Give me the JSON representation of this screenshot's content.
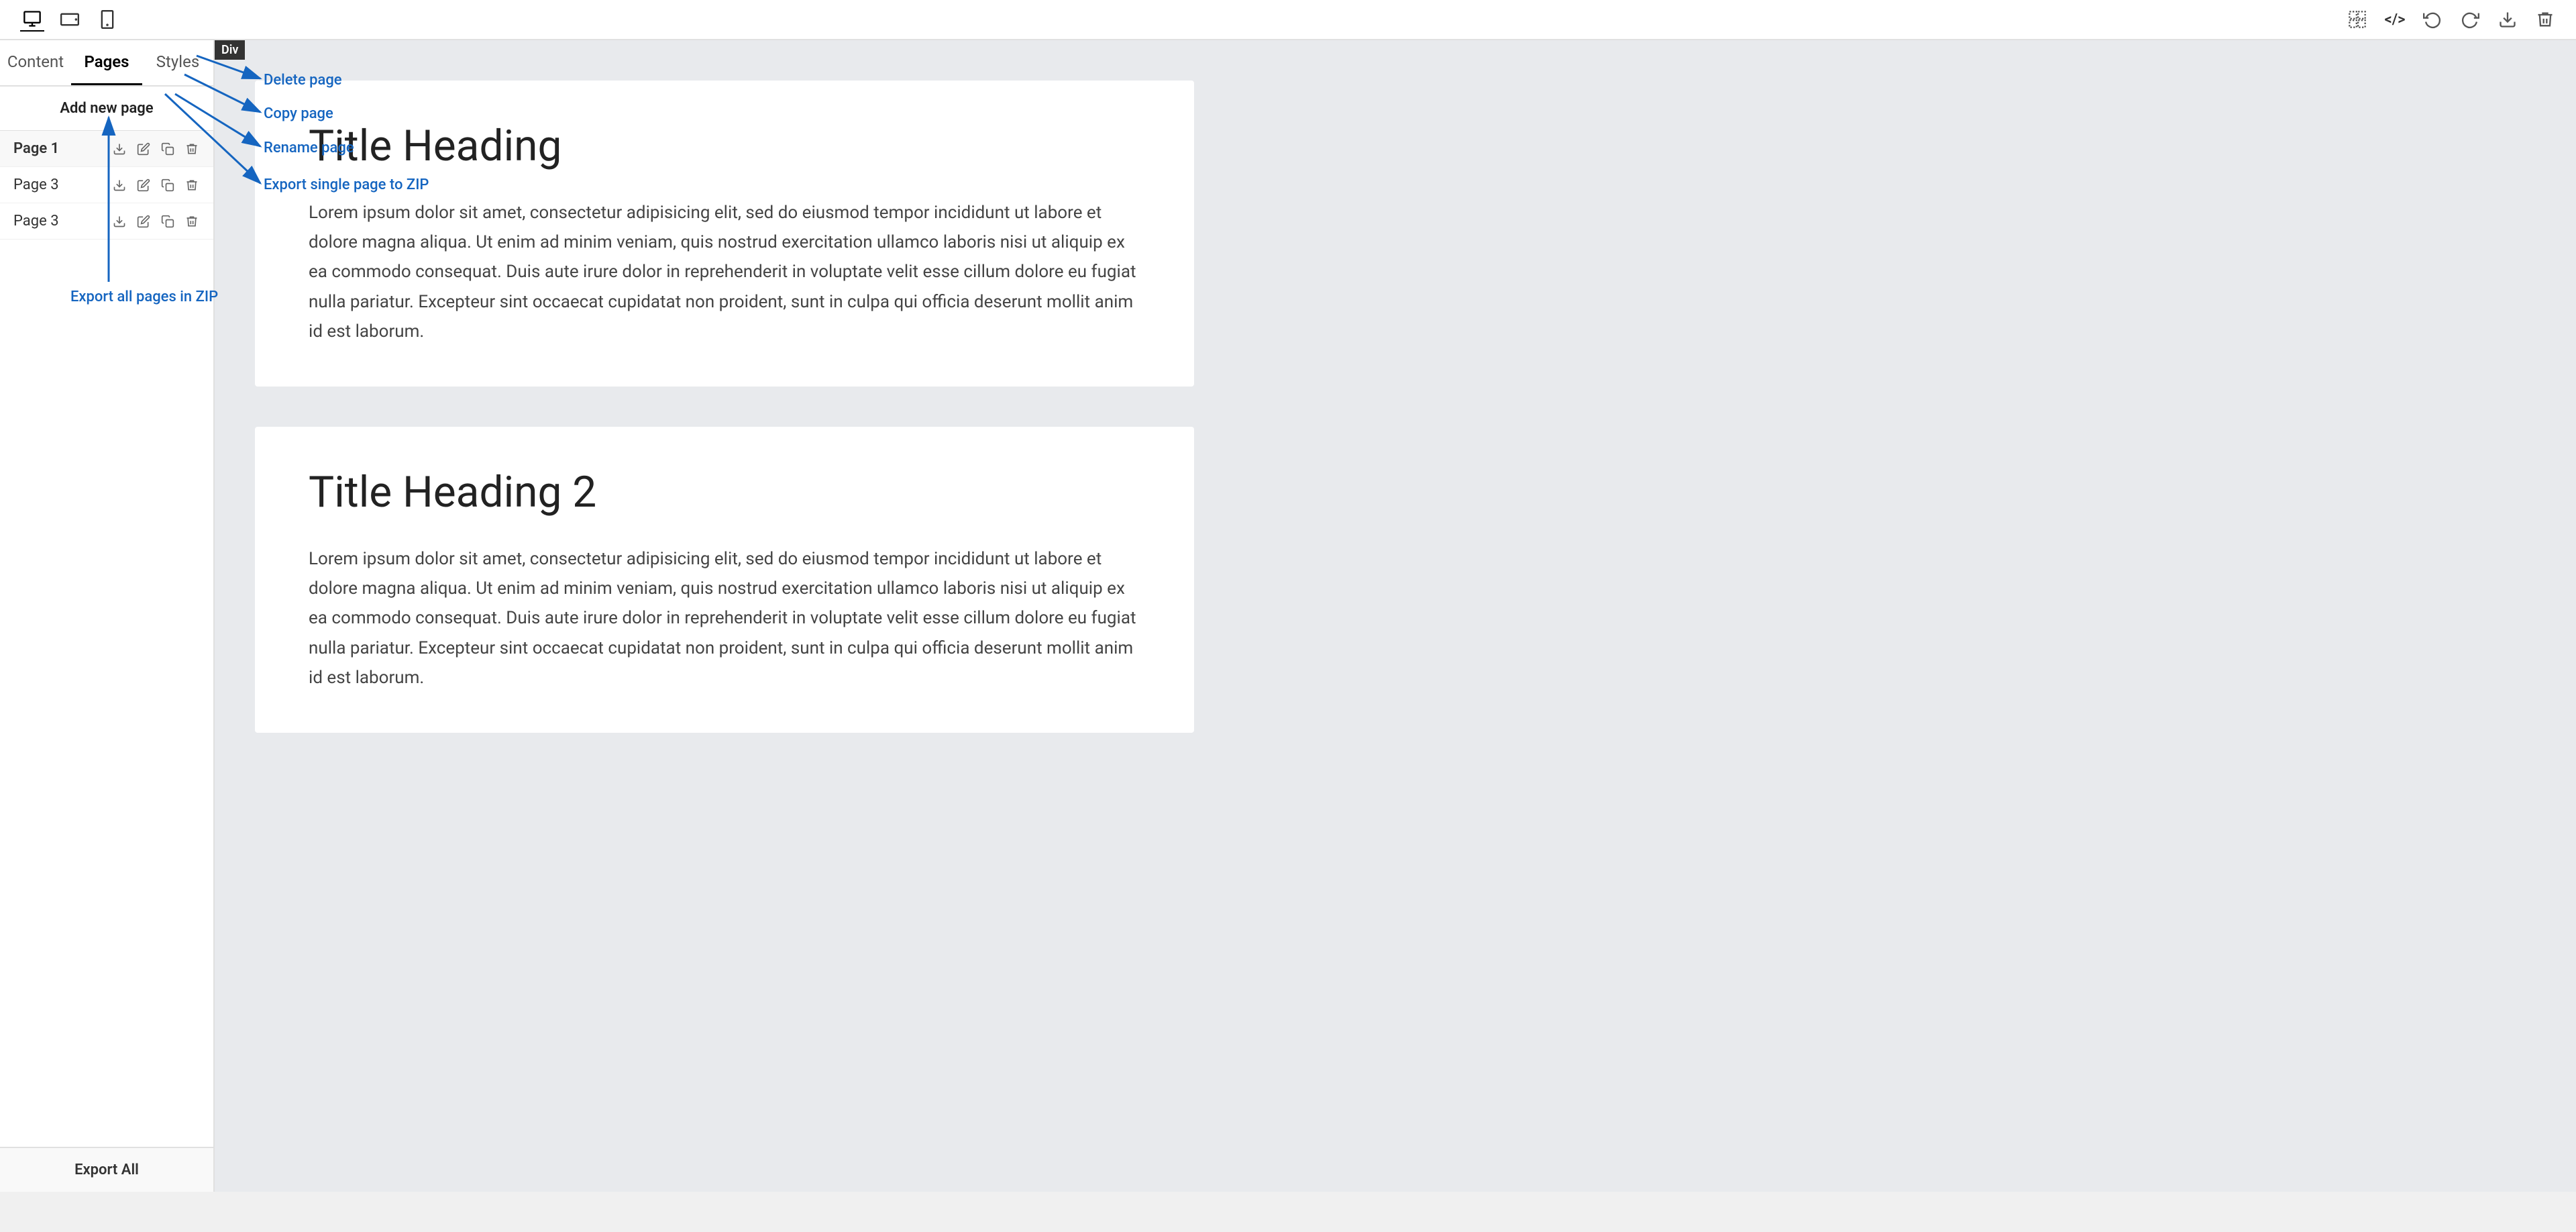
{
  "topbar": {
    "devices": [
      {
        "id": "desktop",
        "label": "Desktop",
        "active": true
      },
      {
        "id": "tablet-landscape",
        "label": "Tablet Landscape",
        "active": false
      },
      {
        "id": "tablet-portrait",
        "label": "Tablet Portrait",
        "active": false
      }
    ],
    "actions": {
      "select_icon": "⊞",
      "code_icon": "</>",
      "undo_icon": "↩",
      "redo_icon": "↪",
      "download_icon": "⬇",
      "delete_icon": "🗑"
    }
  },
  "sidebar": {
    "tabs": [
      {
        "id": "content",
        "label": "Content",
        "active": false
      },
      {
        "id": "pages",
        "label": "Pages",
        "active": true
      },
      {
        "id": "styles",
        "label": "Styles",
        "active": false
      }
    ],
    "add_new_page_label": "Add new page",
    "pages": [
      {
        "id": "page1",
        "name": "Page 1",
        "active": true
      },
      {
        "id": "page3a",
        "name": "Page 3",
        "active": false
      },
      {
        "id": "page3b",
        "name": "Page 3",
        "active": false
      }
    ],
    "export_all_label": "Export All"
  },
  "content": {
    "div_badge": "Div",
    "blocks": [
      {
        "title": "Title Heading",
        "text": "Lorem ipsum dolor sit amet, consectetur adipisicing elit, sed do eiusmod tempor incididunt ut labore et dolore magna aliqua.\nUt enim ad minim veniam, quis nostrud exercitation ullamco laboris nisi ut aliquip ex ea commodo consequat. Duis aute irure dolor\nin reprehenderit in voluptate velit esse cillum dolore eu fugiat nulla pariatur. Excepteur sint occaecat cupidatat non proident, sunt in culpa qui officia deserunt mollit anim id est laborum."
      },
      {
        "title": "Title Heading 2",
        "text": "Lorem ipsum dolor sit amet, consectetur adipisicing elit, sed do eiusmod tempor incididunt ut labore et dolore magna aliqua. Ut enim ad minim veniam, quis nostrud exercitation ullamco laboris nisi ut aliquip ex ea commodo consequat. Duis aute irure dolor in reprehenderit in voluptate velit esse cillum dolore eu fugiat nulla pariatur. Excepteur sint occaecat cupidatat non proident, sunt in culpa qui officia deserunt mollit anim id est laborum."
      }
    ]
  },
  "annotations": {
    "delete_page": "Delete page",
    "copy_page": "Copy page",
    "rename_page": "Rename page",
    "export_single": "Export single page to ZIP",
    "export_all": "Export all pages in ZIP",
    "accent_color": "#1565C0"
  }
}
